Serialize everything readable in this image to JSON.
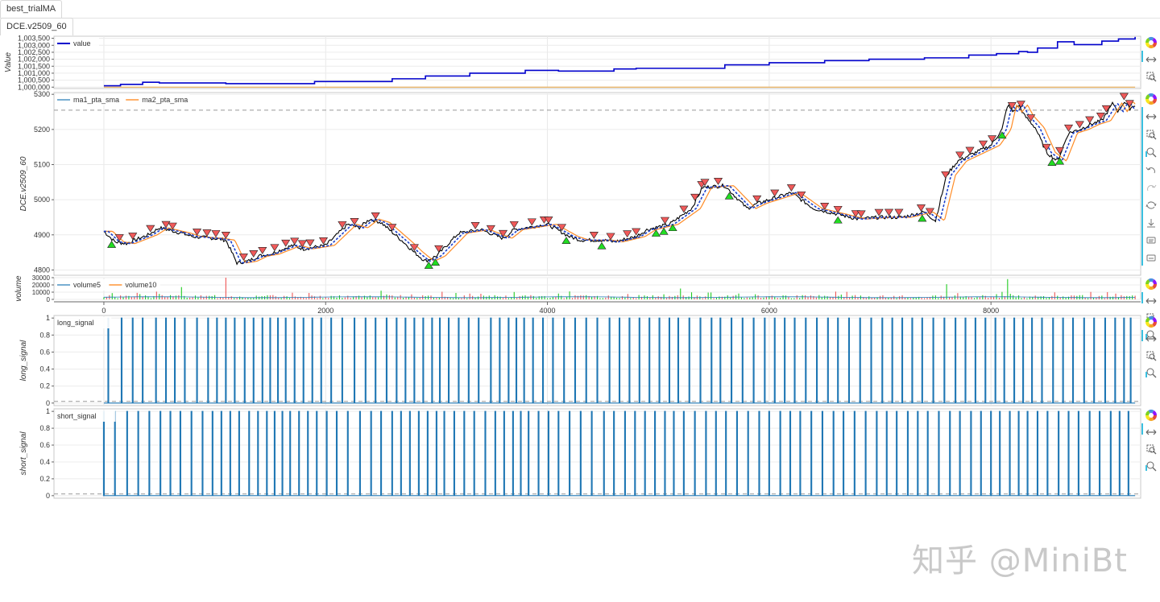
{
  "tabs": {
    "outer": "best_trialMA",
    "inner": "DCE.v2509_60"
  },
  "colors": {
    "value": "#0000cc",
    "baseline": "#e6a23c",
    "price": "#000000",
    "ma1": "#1f77b4",
    "ma2": "#ff7f0e",
    "buy": "#22dd22",
    "sell": "#f05a5a",
    "vol_up": "#22cc22",
    "vol_down": "#ee5555",
    "signal": "#1f77b4"
  },
  "toolbar_icons": [
    "bokeh-logo-icon",
    "pan-icon",
    "box-zoom-icon",
    "wheel-zoom-icon",
    "undo-icon",
    "redo-icon",
    "reset-icon",
    "save-icon",
    "hover-icon",
    "crosshair-icon"
  ],
  "shared_x": {
    "ticks": [
      0,
      2000,
      4000,
      6000,
      8000
    ],
    "tick_labels": [
      "0",
      "2000",
      "4000",
      "6000",
      "8000"
    ],
    "domain": [
      -450,
      9350
    ]
  },
  "watermark": "知乎 @MiniBt",
  "chart_data": [
    {
      "id": "value",
      "type": "line",
      "ylabel": "Value",
      "legend": [
        "value"
      ],
      "ylim": [
        999900,
        1003650
      ],
      "yticks": [
        1000000,
        1000500,
        1001000,
        1001500,
        1002000,
        1002500,
        1003000,
        1003500
      ],
      "ytick_labels": [
        "1,000,000",
        "1,000,500",
        "1,001,000",
        "1,001,500",
        "1,002,000",
        "1,002,500",
        "1,003,000",
        "1,003,500"
      ],
      "series": [
        {
          "name": "value",
          "x": [
            0,
            150,
            350,
            500,
            1100,
            1900,
            2600,
            2900,
            3300,
            3800,
            4100,
            4600,
            4800,
            5600,
            6000,
            6500,
            6900,
            7400,
            7800,
            8050,
            8250,
            8330,
            8420,
            8600,
            8750,
            9000,
            9150,
            9300
          ],
          "y": [
            1000100,
            1000200,
            1000350,
            1000300,
            1000250,
            1000400,
            1000600,
            1000800,
            1001000,
            1001200,
            1001150,
            1001300,
            1001350,
            1001600,
            1001750,
            1001900,
            1002000,
            1002100,
            1002300,
            1002400,
            1002550,
            1002500,
            1002800,
            1003250,
            1003050,
            1003300,
            1003450,
            1003600
          ]
        },
        {
          "name": "baseline",
          "x": [
            0,
            9300
          ],
          "y": [
            1000000,
            1000000
          ]
        }
      ]
    },
    {
      "id": "price",
      "type": "line",
      "ylabel": "DCE.v2509_60",
      "legend": [
        "ma1_pta_sma",
        "ma2_pta_sma"
      ],
      "ylim": [
        4785,
        5305
      ],
      "yticks": [
        4800,
        4900,
        5000,
        5100,
        5200,
        5300
      ],
      "ref_line": 5255,
      "anchors": {
        "x": [
          0,
          100,
          200,
          400,
          500,
          700,
          800,
          1000,
          1100,
          1200,
          1300,
          1400,
          1500,
          1700,
          1800,
          2000,
          2200,
          2300,
          2400,
          2500,
          2700,
          2800,
          2900,
          3000,
          3200,
          3400,
          3600,
          3700,
          4000,
          4200,
          4300,
          4500,
          4600,
          4800,
          4900,
          5100,
          5300,
          5400,
          5600,
          5800,
          5900,
          6200,
          6400,
          6600,
          6800,
          7000,
          7200,
          7400,
          7500,
          7600,
          7700,
          7900,
          8000,
          8100,
          8150,
          8200,
          8250,
          8300,
          8400,
          8500,
          8600,
          8700,
          8800,
          8900,
          9000,
          9100,
          9150,
          9200,
          9250,
          9300
        ],
        "y": [
          4910,
          4880,
          4875,
          4900,
          4920,
          4905,
          4895,
          4890,
          4885,
          4820,
          4825,
          4840,
          4845,
          4870,
          4860,
          4870,
          4930,
          4920,
          4945,
          4935,
          4880,
          4850,
          4825,
          4840,
          4905,
          4915,
          4890,
          4915,
          4930,
          4895,
          4885,
          4885,
          4880,
          4895,
          4915,
          4930,
          4975,
          5035,
          5040,
          4975,
          4990,
          5020,
          4975,
          4960,
          4945,
          4950,
          4950,
          4965,
          4940,
          5070,
          5110,
          5140,
          5155,
          5200,
          5270,
          5250,
          5270,
          5240,
          5205,
          5135,
          5110,
          5190,
          5200,
          5215,
          5225,
          5275,
          5250,
          5280,
          5260,
          5270
        ]
      },
      "markers": [
        {
          "dir": "down",
          "x": [
            140,
            260,
            420,
            560,
            620,
            840,
            930,
            1010,
            1100,
            1260,
            1350,
            1430,
            1540,
            1640,
            1720,
            1790,
            1860,
            1980,
            2150,
            2260,
            2450,
            2600,
            2800,
            3020,
            3350,
            3490,
            3600,
            3700,
            3860,
            3970,
            4010,
            4130,
            4420,
            4570,
            4720,
            4800,
            5060,
            5230,
            5330,
            5390,
            5420,
            5540,
            5890,
            6050,
            6200,
            6290,
            6500,
            6620,
            6780,
            6830,
            6990,
            7080,
            7170,
            7370,
            7450,
            7590,
            7720,
            7810,
            7930,
            8010,
            8190,
            8270,
            8360,
            8500,
            8620,
            8700,
            8800,
            8890,
            8990,
            9040,
            9200,
            9250
          ]
        },
        {
          "dir": "up",
          "x": [
            70,
            2930,
            2990,
            4170,
            4490,
            4980,
            5050,
            5130,
            5640,
            6620,
            7380,
            8100,
            8550,
            8620
          ]
        }
      ]
    },
    {
      "id": "volume",
      "type": "bar",
      "ylabel": "volume",
      "legend": [
        "volume5",
        "volume10"
      ],
      "ylim": [
        0,
        30000
      ],
      "yticks": [
        0,
        10000,
        20000,
        30000
      ],
      "ytick_labels": [
        "0",
        "10000",
        "20000",
        "30000"
      ],
      "spikes": {
        "x": [
          300,
          700,
          1100,
          2500,
          3300,
          4200,
          5200,
          7600,
          8150
        ],
        "y": [
          9000,
          17000,
          30000,
          12000,
          8000,
          11000,
          15000,
          21000,
          28000
        ]
      }
    },
    {
      "id": "long_signal",
      "type": "line",
      "ylabel": "long_signal",
      "legend": [
        "long_signal"
      ],
      "ylim": [
        -0.03,
        1.03
      ],
      "yticks": [
        0,
        0.2,
        0.4,
        0.6,
        0.8,
        1
      ],
      "ref_line": 0.02,
      "x": [
        40,
        160,
        260,
        350,
        470,
        560,
        640,
        730,
        840,
        940,
        1020,
        1100,
        1180,
        1270,
        1350,
        1430,
        1500,
        1570,
        1640,
        1720,
        1800,
        1880,
        1960,
        2050,
        2150,
        2260,
        2360,
        2450,
        2550,
        2640,
        2720,
        2800,
        2880,
        2960,
        3030,
        3110,
        3200,
        3290,
        3380,
        3490,
        3570,
        3650,
        3720,
        3790,
        3870,
        3960,
        4050,
        4150,
        4250,
        4350,
        4450,
        4560,
        4650,
        4740,
        4830,
        4920,
        5010,
        5100,
        5180,
        5280,
        5380,
        5480,
        5560,
        5660,
        5760,
        5860,
        5960,
        6050,
        6140,
        6230,
        6330,
        6430,
        6530,
        6620,
        6720,
        6820,
        6920,
        7020,
        7110,
        7200,
        7290,
        7380,
        7480,
        7580,
        7680,
        7770,
        7860,
        7950,
        8040,
        8120,
        8210,
        8290,
        8370,
        8460,
        8560,
        8650,
        8740,
        8840,
        8930,
        9030,
        9120,
        9200,
        9260
      ]
    },
    {
      "id": "short_signal",
      "type": "line",
      "ylabel": "short_signal",
      "legend": [
        "short_signal"
      ],
      "ylim": [
        -0.03,
        1.03
      ],
      "yticks": [
        0,
        0.2,
        0.4,
        0.6,
        0.8,
        1
      ],
      "ref_line": 0.02,
      "x": [
        0,
        100,
        210,
        310,
        410,
        510,
        600,
        690,
        790,
        890,
        980,
        1060,
        1140,
        1220,
        1310,
        1390,
        1470,
        1540,
        1610,
        1680,
        1760,
        1840,
        1920,
        2010,
        2100,
        2200,
        2310,
        2410,
        2500,
        2600,
        2680,
        2760,
        2840,
        2920,
        3000,
        3070,
        3160,
        3250,
        3340,
        3440,
        3530,
        3610,
        3690,
        3760,
        3830,
        3920,
        4010,
        4100,
        4200,
        4300,
        4400,
        4510,
        4600,
        4700,
        4790,
        4880,
        4970,
        5060,
        5140,
        5230,
        5330,
        5430,
        5520,
        5610,
        5710,
        5810,
        5910,
        6000,
        6100,
        6190,
        6280,
        6380,
        6480,
        6580,
        6670,
        6770,
        6870,
        6970,
        7060,
        7150,
        7250,
        7340,
        7430,
        7530,
        7630,
        7720,
        7820,
        7910,
        8000,
        8080,
        8170,
        8250,
        8330,
        8420,
        8510,
        8610,
        8700,
        8790,
        8890,
        8980,
        9080,
        9160,
        9240
      ]
    }
  ]
}
